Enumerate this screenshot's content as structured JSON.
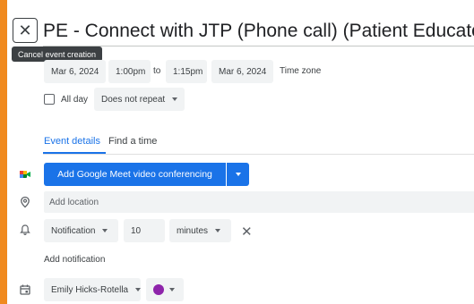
{
  "header": {
    "close_tooltip": "Cancel event creation",
    "title": "PE - Connect with JTP (Phone call) (Patient Educator t"
  },
  "datetime": {
    "start_date": "Mar 6, 2024",
    "start_time": "1:00pm",
    "to_label": "to",
    "end_time": "1:15pm",
    "end_date": "Mar 6, 2024",
    "timezone_label": "Time zone"
  },
  "allday": {
    "label": "All day",
    "checked": false,
    "repeat_value": "Does not repeat"
  },
  "tabs": [
    {
      "label": "Event details",
      "active": true
    },
    {
      "label": "Find a time",
      "active": false
    }
  ],
  "conferencing": {
    "button_label": "Add Google Meet video conferencing"
  },
  "location": {
    "placeholder": "Add location"
  },
  "notification": {
    "type_value": "Notification",
    "amount_value": "10",
    "unit_value": "minutes",
    "add_label": "Add notification"
  },
  "calendar": {
    "owner_value": "Emily Hicks-Rotella",
    "color": "#8e24aa"
  },
  "colors": {
    "accent": "#1a73e8",
    "chip_bg": "#f1f3f4",
    "border_frame": "#f08a1f"
  },
  "icons": {
    "close": "close-icon",
    "meet": "google-meet-icon",
    "location": "location-pin-icon",
    "notification": "bell-icon",
    "calendar": "calendar-icon",
    "remove": "close-icon"
  }
}
